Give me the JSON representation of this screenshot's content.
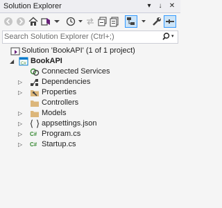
{
  "panel": {
    "title": "Solution Explorer",
    "pin_glyph": "↓",
    "close_glyph": "✕",
    "dropdown_glyph": "▾"
  },
  "toolbar": {
    "icons": [
      "back-icon",
      "forward-icon",
      "home-icon",
      "switch-views-icon",
      "pending-changes-icon",
      "sync-icon",
      "collapse-all-icon",
      "show-all-files-icon",
      "preview-icon",
      "properties-wrench-icon",
      "pin-panel-icon"
    ]
  },
  "search": {
    "placeholder": "Search Solution Explorer (Ctrl+;)"
  },
  "tree": {
    "solution": "Solution 'BookAPI' (1 of 1 project)",
    "project": "BookAPI",
    "items": [
      {
        "label": "Connected Services",
        "icon": "connected-services-icon"
      },
      {
        "label": "Dependencies",
        "icon": "dependencies-icon"
      },
      {
        "label": "Properties",
        "icon": "properties-icon"
      },
      {
        "label": "Controllers",
        "icon": "folder-icon"
      },
      {
        "label": "Models",
        "icon": "folder-icon"
      },
      {
        "label": "appsettings.json",
        "icon": "json-file-icon"
      },
      {
        "label": "Program.cs",
        "icon": "csharp-file-icon",
        "badge": "C#"
      },
      {
        "label": "Startup.cs",
        "icon": "csharp-file-icon",
        "badge": "C#"
      }
    ]
  },
  "colors": {
    "accent": "#007acc",
    "folder": "#dcb67a",
    "csharp": "#388a34"
  }
}
